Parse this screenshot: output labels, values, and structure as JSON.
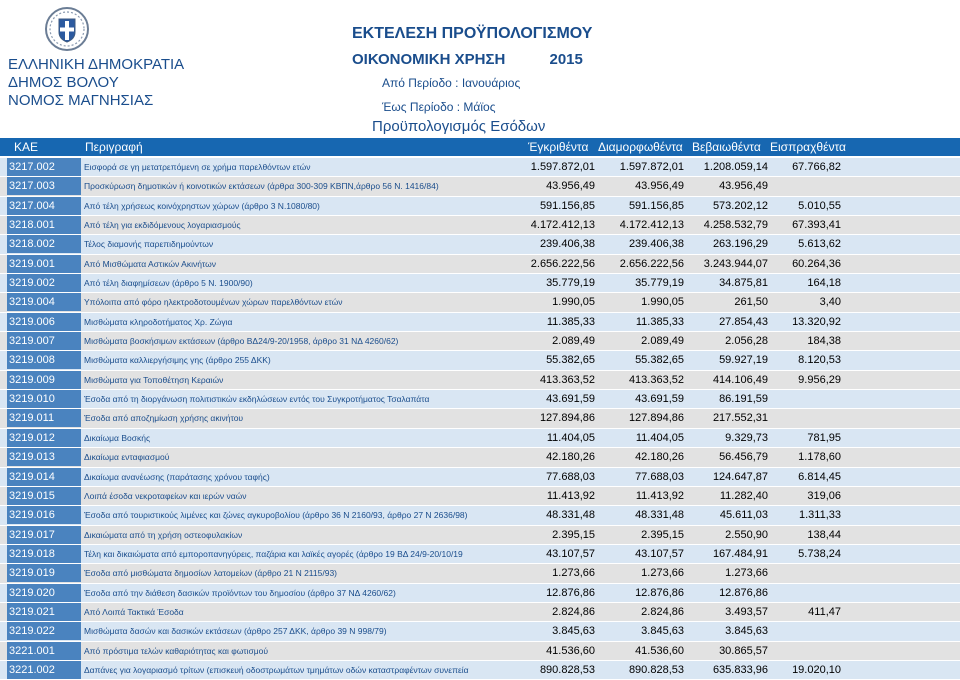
{
  "header": {
    "org_line1": "ΕΛΛΗΝΙΚΗ ΔΗΜΟΚΡΑΤΙΑ",
    "org_line2": "ΔΗΜΟΣ ΒΟΛΟΥ",
    "org_line3": "ΝΟΜΟΣ ΜΑΓΝΗΣΙΑΣ",
    "title": "ΕΚΤΕΛΕΣΗ ΠΡΟΫΠΟΛΟΓΙΣΜΟΥ",
    "fiscal_year_label": "ΟΙΚΟΝΟΜΙΚΗ ΧΡΗΣΗ",
    "fiscal_year": "2015",
    "period_from": "Από Περίοδο : Ιανουάριος",
    "period_to": "Έως Περίοδο : Μάϊος",
    "section": "Προϋπολογισμός Εσόδων"
  },
  "columns": {
    "kae": "ΚΑΕ",
    "description": "Περιγραφή",
    "approved": "Έγκριθέντα",
    "shaped": "Διαμορφωθέντα",
    "certified": "Βεβαιωθέντα",
    "collected": "Εισπραχθέντα"
  },
  "rows": [
    {
      "kae": "3217.002",
      "desc": "Εισφορά σε γη μετατρεπόμενη σε χρήμα παρελθόντων ετών",
      "a": "1.597.872,01",
      "b": "1.597.872,01",
      "c": "1.208.059,14",
      "d": "67.766,82"
    },
    {
      "kae": "3217.003",
      "desc": "Προσκύρωση δημοτικών ή κοινοτικών εκτάσεων (άρθρα 300-309 ΚΒΠΝ,άρθρο 56 Ν. 1416/84)",
      "a": "43.956,49",
      "b": "43.956,49",
      "c": "43.956,49",
      "d": ""
    },
    {
      "kae": "3217.004",
      "desc": "Από τέλη χρήσεως κοινόχρηστων χώρων (άρθρο 3 Ν.1080/80)",
      "a": "591.156,85",
      "b": "591.156,85",
      "c": "573.202,12",
      "d": "5.010,55"
    },
    {
      "kae": "3218.001",
      "desc": "Από τέλη για εκδιδόμενους λογαριασμούς",
      "a": "4.172.412,13",
      "b": "4.172.412,13",
      "c": "4.258.532,79",
      "d": "67.393,41"
    },
    {
      "kae": "3218.002",
      "desc": "Τέλος διαμονής παρεπιδημούντων",
      "a": "239.406,38",
      "b": "239.406,38",
      "c": "263.196,29",
      "d": "5.613,62"
    },
    {
      "kae": "3219.001",
      "desc": "Από Μισθώματα Αστικών Ακινήτων",
      "a": "2.656.222,56",
      "b": "2.656.222,56",
      "c": "3.243.944,07",
      "d": "60.264,36"
    },
    {
      "kae": "3219.002",
      "desc": "Από τέλη διαφημίσεων (άρθρο 5 Ν. 1900/90)",
      "a": "35.779,19",
      "b": "35.779,19",
      "c": "34.875,81",
      "d": "164,18"
    },
    {
      "kae": "3219.004",
      "desc": "Υπόλοιπα από φόρο ηλεκτροδοτουμένων χώρων παρελθόντων ετών",
      "a": "1.990,05",
      "b": "1.990,05",
      "c": "261,50",
      "d": "3,40"
    },
    {
      "kae": "3219.006",
      "desc": "Μισθώματα κληροδοτήματος Χρ. Ζώγια",
      "a": "11.385,33",
      "b": "11.385,33",
      "c": "27.854,43",
      "d": "13.320,92"
    },
    {
      "kae": "3219.007",
      "desc": "Μισθώματα βοσκήσιμων εκτάσεων (άρθρο ΒΔ24/9-20/1958, άρθρο 31 ΝΔ 4260/62)",
      "a": "2.089,49",
      "b": "2.089,49",
      "c": "2.056,28",
      "d": "184,38"
    },
    {
      "kae": "3219.008",
      "desc": "Μισθώματα καλλιεργήσιμης γης (άρθρο 255 ΔΚΚ)",
      "a": "55.382,65",
      "b": "55.382,65",
      "c": "59.927,19",
      "d": "8.120,53"
    },
    {
      "kae": "3219.009",
      "desc": "Μισθώματα για Τοποθέτηση Κεραιών",
      "a": "413.363,52",
      "b": "413.363,52",
      "c": "414.106,49",
      "d": "9.956,29"
    },
    {
      "kae": "3219.010",
      "desc": "Έσοδα από τη διοργάνωση πολιτιστικών εκδηλώσεων εντός του Συγκροτήματος Τσαλαπάτα",
      "a": "43.691,59",
      "b": "43.691,59",
      "c": "86.191,59",
      "d": ""
    },
    {
      "kae": "3219.011",
      "desc": "Έσοδα από αποζημίωση χρήσης ακινήτου",
      "a": "127.894,86",
      "b": "127.894,86",
      "c": "217.552,31",
      "d": ""
    },
    {
      "kae": "3219.012",
      "desc": "Δικαίωμα Βοσκής",
      "a": "11.404,05",
      "b": "11.404,05",
      "c": "9.329,73",
      "d": "781,95"
    },
    {
      "kae": "3219.013",
      "desc": "Δικαίωμα ενταφιασμού",
      "a": "42.180,26",
      "b": "42.180,26",
      "c": "56.456,79",
      "d": "1.178,60"
    },
    {
      "kae": "3219.014",
      "desc": "Δικαίωμα ανανέωσης (παράτασης χρόνου ταφής)",
      "a": "77.688,03",
      "b": "77.688,03",
      "c": "124.647,87",
      "d": "6.814,45"
    },
    {
      "kae": "3219.015",
      "desc": "Λοιπά έσοδα νεκροταφείων και ιερών ναών",
      "a": "11.413,92",
      "b": "11.413,92",
      "c": "11.282,40",
      "d": "319,06"
    },
    {
      "kae": "3219.016",
      "desc": "Έσοδα από τουριστικούς λιμένες και ζώνες αγκυροβολίου (άρθρο 36 Ν 2160/93, άρθρο 27 Ν 2636/98)",
      "a": "48.331,48",
      "b": "48.331,48",
      "c": "45.611,03",
      "d": "1.311,33"
    },
    {
      "kae": "3219.017",
      "desc": "Δικαιώματα από τη χρήση οστεοφυλακίων",
      "a": "2.395,15",
      "b": "2.395,15",
      "c": "2.550,90",
      "d": "138,44"
    },
    {
      "kae": "3219.018",
      "desc": "Τέλη και δικαιώματα από εμποροπανηγύρεις, παζάρια και λαϊκές αγορές (άρθρο 19 ΒΔ 24/9-20/10/19",
      "a": "43.107,57",
      "b": "43.107,57",
      "c": "167.484,91",
      "d": "5.738,24"
    },
    {
      "kae": "3219.019",
      "desc": "Έσοδα από μισθώματα δημοσίων λατομείων (άρθρο 21 Ν 2115/93)",
      "a": "1.273,66",
      "b": "1.273,66",
      "c": "1.273,66",
      "d": ""
    },
    {
      "kae": "3219.020",
      "desc": "Έσοδα από την διάθεση δασικών προϊόντων του δημοσίου (άρθρο 37 ΝΔ 4260/62)",
      "a": "12.876,86",
      "b": "12.876,86",
      "c": "12.876,86",
      "d": ""
    },
    {
      "kae": "3219.021",
      "desc": "Από Λοιπά Τακτικά Έσοδα",
      "a": "2.824,86",
      "b": "2.824,86",
      "c": "3.493,57",
      "d": "411,47"
    },
    {
      "kae": "3219.022",
      "desc": "Μισθώματα δασών και δασικών εκτάσεων (άρθρο 257 ΔΚΚ, άρθρο 39 Ν 998/79)",
      "a": "3.845,63",
      "b": "3.845,63",
      "c": "3.845,63",
      "d": ""
    },
    {
      "kae": "3221.001",
      "desc": "Από πρόστιμα τελών καθαριότητας και φωτισμού",
      "a": "41.536,60",
      "b": "41.536,60",
      "c": "30.865,57",
      "d": ""
    },
    {
      "kae": "3221.002",
      "desc": "Δαπάνες για λογαριασμό τρίτων (επισκευή οδοστρωμάτων τμημάτων οδών καταστραφέντων συνεπεία",
      "a": "890.828,53",
      "b": "890.828,53",
      "c": "635.833,96",
      "d": "19.020,10"
    }
  ],
  "colors": {
    "header_bar": "#1767b1",
    "kae_cell": "#4a83bf",
    "title_text": "#1a4d8c"
  }
}
